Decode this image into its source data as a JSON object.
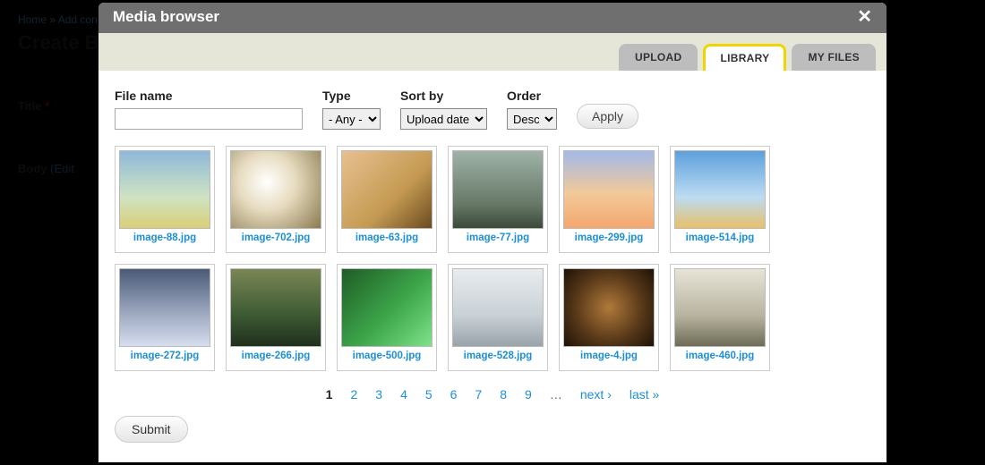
{
  "background": {
    "breadcrumb": {
      "home": "Home",
      "add": "Add con"
    },
    "page_title": "Create Bas",
    "title_label": "Title",
    "required_marker": "*",
    "body_label": "Body",
    "edit_suffix": "(Edit"
  },
  "modal": {
    "title": "Media browser",
    "close_glyph": "✕"
  },
  "tabs": {
    "upload": "UPLOAD",
    "library": "LIBRARY",
    "myfiles": "MY FILES",
    "active": "library"
  },
  "filters": {
    "file_name": {
      "label": "File name",
      "value": ""
    },
    "type": {
      "label": "Type",
      "selected": "- Any -",
      "options": [
        "- Any -"
      ]
    },
    "sort_by": {
      "label": "Sort by",
      "selected": "Upload date",
      "options": [
        "Upload date"
      ]
    },
    "order": {
      "label": "Order",
      "selected": "Desc",
      "options": [
        "Desc"
      ]
    },
    "apply_label": "Apply"
  },
  "grid": {
    "items": [
      {
        "label": "image-88.jpg",
        "css": "img-88"
      },
      {
        "label": "image-702.jpg",
        "css": "img-702"
      },
      {
        "label": "image-63.jpg",
        "css": "img-63"
      },
      {
        "label": "image-77.jpg",
        "css": "img-77"
      },
      {
        "label": "image-299.jpg",
        "css": "img-299"
      },
      {
        "label": "image-514.jpg",
        "css": "img-514"
      },
      {
        "label": "image-272.jpg",
        "css": "img-272"
      },
      {
        "label": "image-266.jpg",
        "css": "img-266"
      },
      {
        "label": "image-500.jpg",
        "css": "img-500"
      },
      {
        "label": "image-528.jpg",
        "css": "img-528"
      },
      {
        "label": "image-4.jpg",
        "css": "img-4"
      },
      {
        "label": "image-460.jpg",
        "css": "img-460"
      }
    ]
  },
  "pager": {
    "pages": [
      "1",
      "2",
      "3",
      "4",
      "5",
      "6",
      "7",
      "8",
      "9"
    ],
    "current": "1",
    "ellipsis": "…",
    "next": "next ›",
    "last": "last »"
  },
  "submit_label": "Submit"
}
